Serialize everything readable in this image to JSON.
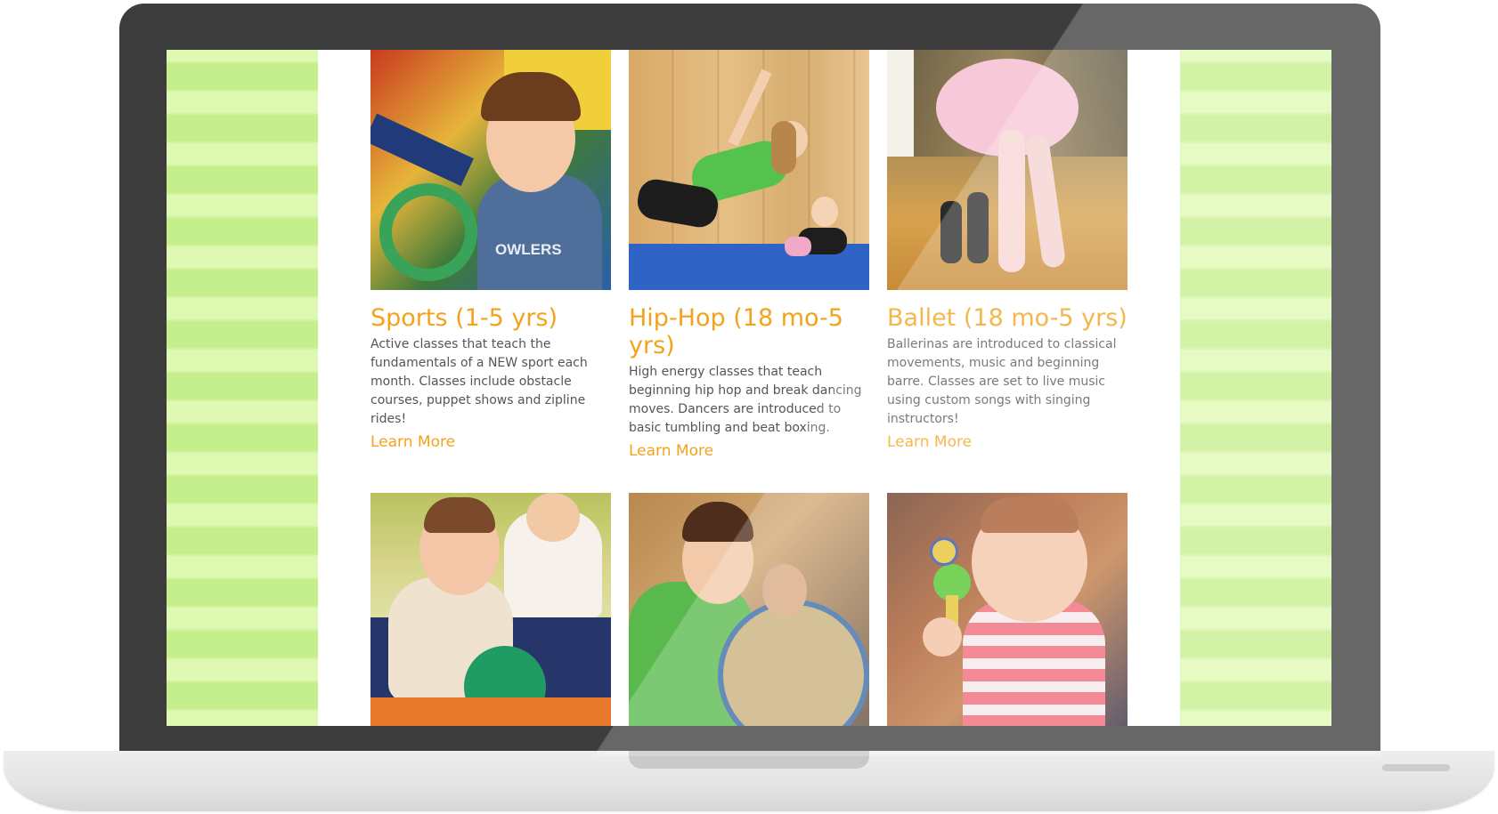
{
  "classes": [
    {
      "title": "Sports (1-5 yrs)",
      "description": "Active classes that teach the fundamentals of a NEW sport each month. Classes include obstacle courses, puppet shows and zipline rides!",
      "link": "Learn More",
      "shirt_text": "OWLERS"
    },
    {
      "title": "Hip-Hop (18 mo-5 yrs)",
      "description": "High energy classes that teach beginning hip hop and break dancing moves. Dancers are introduced to basic tumbling and beat boxing.",
      "link": "Learn More"
    },
    {
      "title": "Ballet (18 mo-5 yrs)",
      "description": "Ballerinas are introduced to classical movements, music and beginning barre. Classes are set to live music using custom songs with singing instructors!",
      "link": "Learn More"
    }
  ],
  "colors": {
    "accent": "#f2a31b",
    "stripe_light": "#dff9b3",
    "stripe_dark": "#c5ee8c",
    "laptop_bezel": "#3c3c3c"
  }
}
